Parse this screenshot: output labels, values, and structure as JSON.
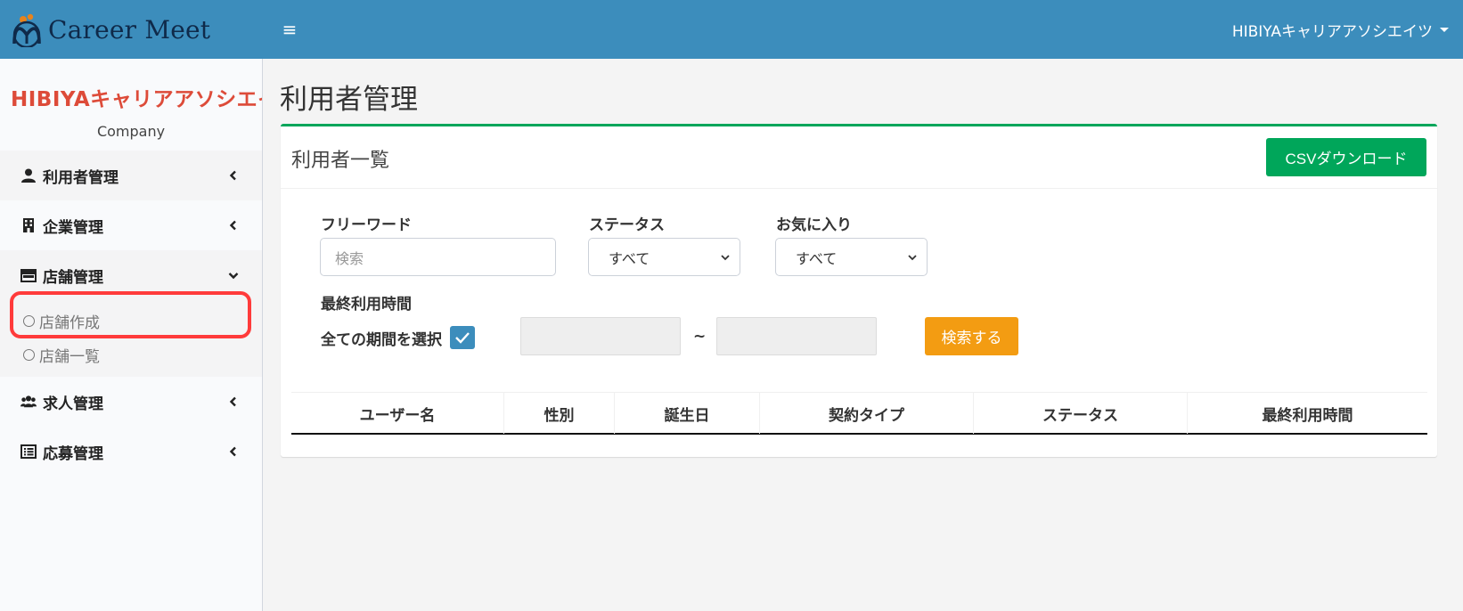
{
  "header": {
    "brand_name": "Career Meet",
    "user_name": "HIBIYAキャリアアソシエイツ"
  },
  "sidebar": {
    "company_name": "HIBIYAキャリアアソシエイツ",
    "company_type": "Company",
    "items": [
      {
        "label": "利用者管理",
        "icon": "user-icon"
      },
      {
        "label": "企業管理",
        "icon": "building-icon"
      },
      {
        "label": "店舗管理",
        "icon": "store-icon"
      },
      {
        "label": "求人管理",
        "icon": "users-icon"
      },
      {
        "label": "応募管理",
        "icon": "list-icon"
      }
    ],
    "store_submenu": [
      {
        "label": "店舗作成"
      },
      {
        "label": "店舗一覧"
      }
    ]
  },
  "main": {
    "page_title": "利用者管理",
    "box_title": "利用者一覧",
    "csv_button": "CSVダウンロード",
    "filters": {
      "free_word_label": "フリーワード",
      "free_word_placeholder": "検索",
      "status_label": "ステータス",
      "status_value": "すべて",
      "favorite_label": "お気に入り",
      "favorite_value": "すべて",
      "last_used_label": "最終利用時間",
      "all_period_label": "全ての期間を選択",
      "all_period_checked": true,
      "range_separator": "~",
      "search_button": "検索する"
    },
    "table": {
      "columns": [
        "ユーザー名",
        "性別",
        "誕生日",
        "契約タイプ",
        "ステータス",
        "最終利用時間"
      ]
    }
  },
  "colors": {
    "header_bg": "#3c8dbc",
    "company_name": "#dd4b39",
    "box_accent": "#00a65a",
    "csv_button": "#00a65a",
    "search_button": "#f39c12",
    "checkbox": "#3c8dbc",
    "highlight": "#ff3b3b"
  }
}
